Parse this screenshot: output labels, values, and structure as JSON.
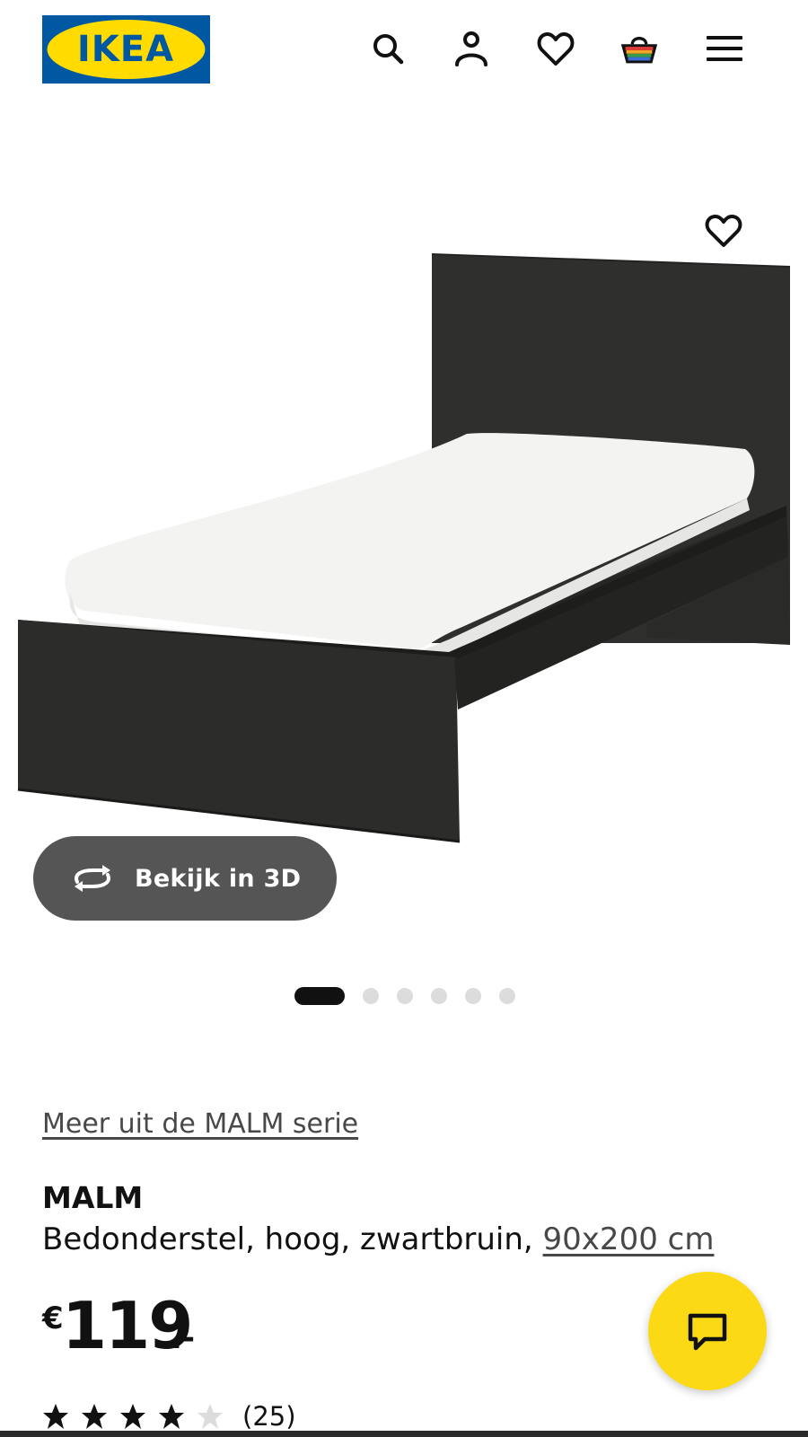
{
  "header": {
    "logo_text": "IKEA",
    "brand_colors": {
      "blue": "#0058a3",
      "yellow": "#ffdb00"
    },
    "icons": [
      "search-icon",
      "account-icon",
      "heart-icon",
      "shopping-bag-icon",
      "menu-icon"
    ]
  },
  "gallery": {
    "favorite_icon": "heart-icon",
    "view_3d": {
      "icon": "rotate-3d-icon",
      "label": "Bekijk in 3D"
    },
    "total_images": 6,
    "active_index": 0
  },
  "product": {
    "series_link": "Meer uit de MALM serie",
    "name": "MALM",
    "description": "Bedonderstel, hoog, zwartbruin, ",
    "size_link": "90x200 cm",
    "price": {
      "currency": "€",
      "integer": "119",
      "decimal": ".-"
    },
    "rating": {
      "stars": 4,
      "max": 5,
      "review_count": "(25)"
    }
  },
  "chat": {
    "icon": "chat-icon",
    "color": "#fbd914"
  }
}
